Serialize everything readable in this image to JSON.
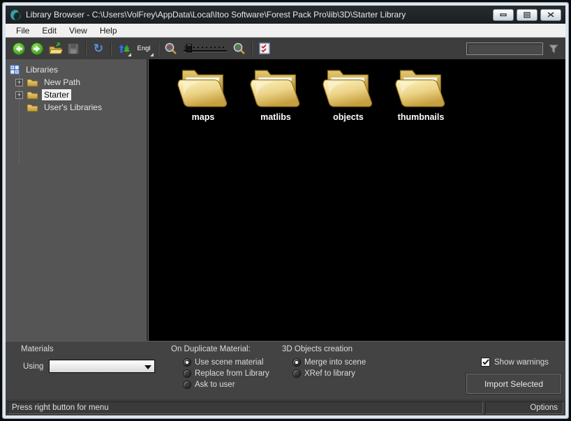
{
  "window": {
    "title": "Library Browser - C:\\Users\\VolFrey\\AppData\\Local\\Itoo Software\\Forest Pack Pro\\lib\\3D\\Starter Library"
  },
  "menu": {
    "items": [
      "File",
      "Edit",
      "View",
      "Help"
    ]
  },
  "toolbar": {
    "language_label": "Engl",
    "search": {
      "value": ""
    }
  },
  "sidebar": {
    "root_label": "Libraries",
    "items": [
      {
        "label": "New Path",
        "expandable": true,
        "selected": false
      },
      {
        "label": "Starter",
        "expandable": true,
        "selected": true
      },
      {
        "label": "User's Libraries",
        "expandable": false,
        "selected": false
      }
    ]
  },
  "content": {
    "folders": [
      {
        "label": "maps"
      },
      {
        "label": "matlibs"
      },
      {
        "label": "objects"
      },
      {
        "label": "thumbnails"
      }
    ]
  },
  "bottom_panel": {
    "materials": {
      "header": "Materials",
      "using_label": "Using",
      "dropdown_value": ""
    },
    "duplicate_material": {
      "header": "On Duplicate Material:",
      "options": [
        {
          "label": "Use scene material",
          "selected": true
        },
        {
          "label": "Replace from Library",
          "selected": false
        },
        {
          "label": "Ask to user",
          "selected": false
        }
      ]
    },
    "objects_creation": {
      "header": "3D Objects creation",
      "options": [
        {
          "label": "Merge into scene",
          "selected": true
        },
        {
          "label": "XRef to library",
          "selected": false
        }
      ]
    },
    "show_warnings": {
      "label": "Show warnings",
      "checked": true
    },
    "import_button_label": "Import Selected"
  },
  "status_bar": {
    "message": "Press right button for menu",
    "options_label": "Options"
  },
  "colors": {
    "frame": "#dde6ee",
    "toolbar_bg": "#3d3d3d",
    "sidebar_bg": "#555555",
    "content_bg": "#000000",
    "selection_bg": "#f0f0f0",
    "folder_yellow": "#e7cd7e",
    "accent_green": "#3fae3f"
  }
}
